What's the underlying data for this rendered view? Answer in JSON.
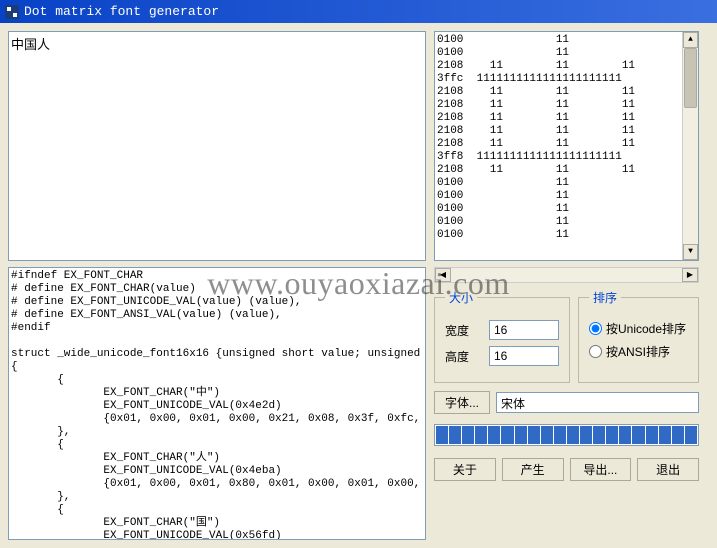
{
  "title": "Dot matrix font generator",
  "input_text": "中国人",
  "hex_lines": [
    "0100              11",
    "0100              11",
    "2108    11        11        11",
    "3ffc  1111111111111111111111",
    "2108    11        11        11",
    "2108    11        11        11",
    "2108    11        11        11",
    "2108    11        11        11",
    "2108    11        11        11",
    "3ff8  1111111111111111111111",
    "2108    11        11        11",
    "0100              11",
    "0100              11",
    "0100              11",
    "0100              11",
    "0100              11"
  ],
  "code_text": "#ifndef EX_FONT_CHAR\n# define EX_FONT_CHAR(value)\n# define EX_FONT_UNICODE_VAL(value) (value),\n# define EX_FONT_ANSI_VAL(value) (value),\n#endif\n\nstruct _wide_unicode_font16x16 {unsigned short value; unsigned c\n{\n       {\n              EX_FONT_CHAR(\"中\")\n              EX_FONT_UNICODE_VAL(0x4e2d)\n              {0x01, 0x00, 0x01, 0x00, 0x21, 0x08, 0x3f, 0xfc,\n       },\n       {\n              EX_FONT_CHAR(\"人\")\n              EX_FONT_UNICODE_VAL(0x4eba)\n              {0x01, 0x00, 0x01, 0x80, 0x01, 0x00, 0x01, 0x00,\n       },\n       {\n              EX_FONT_CHAR(\"国\")\n              EX_FONT_UNICODE_VAL(0x56fd)",
  "size": {
    "legend": "大小",
    "width_label": "宽度",
    "width_value": "16",
    "height_label": "高度",
    "height_value": "16"
  },
  "sort": {
    "legend": "排序",
    "unicode_label": "按Unicode排序",
    "ansi_label": "按ANSI排序"
  },
  "font_btn": "字体...",
  "font_name": "宋体",
  "buttons": {
    "about": "关于",
    "generate": "产生",
    "export": "导出...",
    "exit": "退出"
  },
  "watermark": "www.ouyaoxiazai.com",
  "progress_segments": 20
}
